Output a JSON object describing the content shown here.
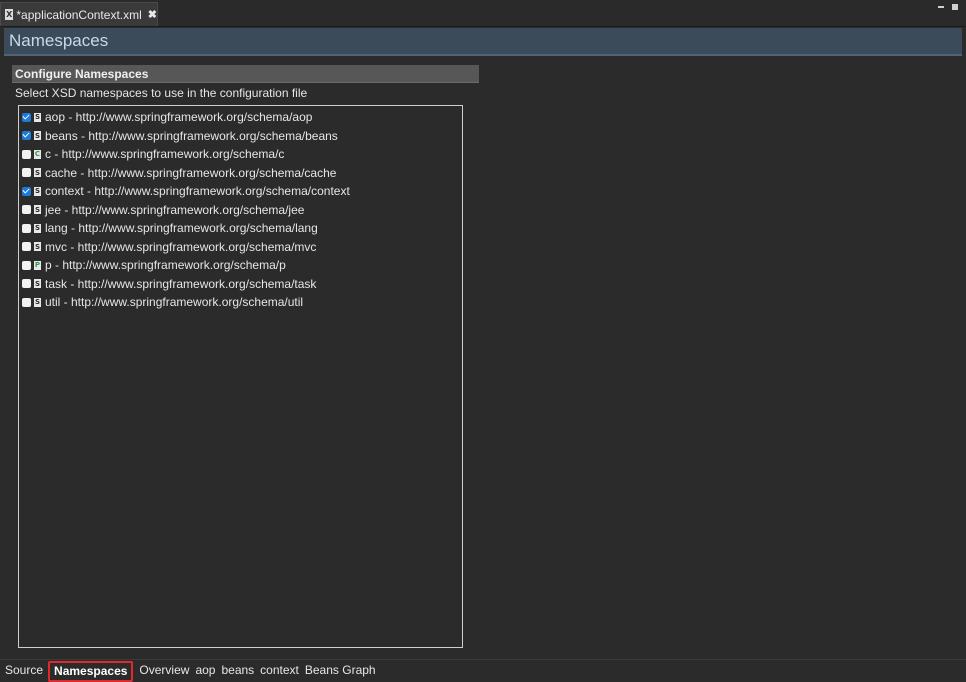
{
  "editor_tab": {
    "title": "*applicationContext.xml",
    "close_glyph": "✖",
    "icon": "xml-file-icon"
  },
  "page": {
    "title": "Namespaces"
  },
  "section": {
    "title": "Configure Namespaces",
    "description": "Select XSD namespaces to use in the configuration file"
  },
  "namespaces": [
    {
      "label": "aop - http://www.springframework.org/schema/aop",
      "checked": true,
      "icon": "S"
    },
    {
      "label": "beans - http://www.springframework.org/schema/beans",
      "checked": true,
      "icon": "S"
    },
    {
      "label": "c - http://www.springframework.org/schema/c",
      "checked": false,
      "icon": "C"
    },
    {
      "label": "cache - http://www.springframework.org/schema/cache",
      "checked": false,
      "icon": "S"
    },
    {
      "label": "context - http://www.springframework.org/schema/context",
      "checked": true,
      "icon": "S"
    },
    {
      "label": "jee - http://www.springframework.org/schema/jee",
      "checked": false,
      "icon": "S"
    },
    {
      "label": "lang - http://www.springframework.org/schema/lang",
      "checked": false,
      "icon": "S"
    },
    {
      "label": "mvc - http://www.springframework.org/schema/mvc",
      "checked": false,
      "icon": "S"
    },
    {
      "label": "p - http://www.springframework.org/schema/p",
      "checked": false,
      "icon": "P"
    },
    {
      "label": "task - http://www.springframework.org/schema/task",
      "checked": false,
      "icon": "S"
    },
    {
      "label": "util - http://www.springframework.org/schema/util",
      "checked": false,
      "icon": "S"
    }
  ],
  "bottom_tabs": [
    {
      "label": "Source",
      "active": false
    },
    {
      "label": "Namespaces",
      "active": true
    },
    {
      "label": "Overview",
      "active": false
    },
    {
      "label": "aop",
      "active": false
    },
    {
      "label": "beans",
      "active": false
    },
    {
      "label": "context",
      "active": false
    },
    {
      "label": "Beans Graph",
      "active": false
    }
  ]
}
